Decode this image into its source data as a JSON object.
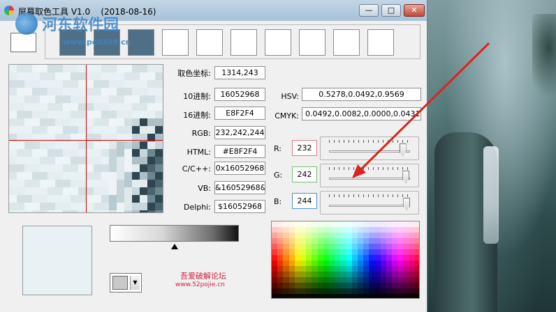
{
  "window": {
    "title": "屏幕取色工具 V1.0    (2018-08-16)",
    "minimize_glyph": "—",
    "maximize_glyph": "□",
    "close_glyph": "✕"
  },
  "watermark": {
    "name": "河东软件园",
    "url": "www.pc0359.cn"
  },
  "current_color": "#FFFFFF",
  "history_colors": [
    "#4f6f86",
    "#4f6f86",
    "#4f6f86",
    "#FFFFFF",
    "#FFFFFF",
    "#FFFFFF",
    "#FFFFFF",
    "#FFFFFF",
    "#FFFFFF",
    "#FFFFFF"
  ],
  "fields": {
    "coord_label": "取色坐标:",
    "coord_value": "1314,243",
    "dec_label": "10进制:",
    "dec_value": "16052968",
    "hex_label": "16进制:",
    "hex_value": "E8F2F4",
    "rgb_label": "RGB:",
    "rgb_value": "232,242,244",
    "html_label": "HTML:",
    "html_value": "#E8F2F4",
    "cpp_label": "C/C++:",
    "cpp_value": "0x16052968",
    "vb_label": "VB:",
    "vb_value": "&16052968&",
    "delphi_label": "Delphi:",
    "delphi_value": "$16052968",
    "hsv_label": "HSV:",
    "hsv_value": "0.5278,0.0492,0.9569",
    "cmyk_label": "CMYK:",
    "cmyk_value": "0.0492,0.0082,0.0000,0.0431"
  },
  "sliders": [
    {
      "label": "R:",
      "value": "232",
      "level": 0.91,
      "box_color": "#e07a8a"
    },
    {
      "label": "G:",
      "value": "242",
      "level": 0.95,
      "box_color": "#6cc46c"
    },
    {
      "label": "B:",
      "value": "244",
      "level": 0.96,
      "box_color": "#4d8fd6"
    }
  ],
  "preview_color": "#E8F2F4",
  "gradient_marker": 0.5,
  "credit": {
    "name": "吾爱破解论坛",
    "url": "www.52pojie.cn"
  },
  "colors": {
    "crosshair": "#D10000",
    "arrow": "#D8261E"
  }
}
